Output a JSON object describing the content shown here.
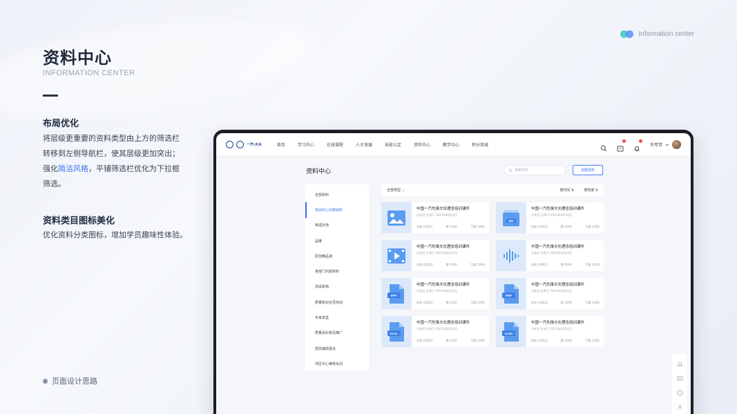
{
  "intro": {
    "title": "资料中心",
    "subtitle": "INFORMATION CENTER",
    "section1_heading": "布局优化",
    "section1_line1": "将层级更重要的资料类型由上方的筛选栏",
    "section1_line2": "转移到左侧导航栏，使其层级更加突出；",
    "section1_line3_pre": "强化",
    "section1_line3_highlight": "简洁风格",
    "section1_line3_post": "，平铺筛选栏优化为下拉框",
    "section1_line4": "筛选。",
    "section2_heading": "资料类目图标美化",
    "section2_text": "优化资料分类图标，增加学员趣味性体验。",
    "footer_note": "页面设计思路",
    "badge_label": "Information center"
  },
  "app": {
    "brand_text": "一汽·大众",
    "nav": [
      "首页",
      "学习中心",
      "在线课程",
      "人才发展",
      "技能认定",
      "资料中心",
      "教学中心",
      "积分商城"
    ],
    "user_name": "许可可",
    "page_title": "资料中心",
    "search_placeholder": "搜索资料",
    "create_button": "创建资料",
    "side_items": [
      "全部资料",
      "培训中心内部资料",
      "英语天地",
      "品推",
      "原创精品课",
      "各部门内部资料",
      "测试新档",
      "质量知识全员培训",
      "专家讲堂",
      "质量百科普及推广",
      "党风廉政建设",
      "冲压中心维修车间"
    ],
    "active_side_index": 1,
    "filter": {
      "type_select": "全部类型",
      "sort_time": "按时间",
      "sort_hot": "按热度"
    },
    "cards": [
      {
        "icon": "image-icon",
        "title": "中国一汽先锋文化理念培训课件",
        "author": "冯东武",
        "sharer": "分享于",
        "date": "2021年8月10日",
        "views": "浏览 (1002)",
        "likes": "赞 (100)",
        "downloads": "下载 (100)"
      },
      {
        "icon": "zip-icon",
        "title": "中国一汽先锋文化理念培训课件",
        "author": "冯东武",
        "sharer": "分享于",
        "date": "2021年8月10日",
        "views": "浏览 (1002)",
        "likes": "赞 (100)",
        "downloads": "下载 (100)"
      },
      {
        "icon": "video-icon",
        "title": "中国一汽先锋文化理念培训课件",
        "author": "冯东武",
        "sharer": "分享于",
        "date": "2021年8月10日",
        "views": "浏览 (1002)",
        "likes": "赞 (100)",
        "downloads": "下载 (100)"
      },
      {
        "icon": "audio-icon",
        "title": "中国一汽先锋文化理念培训课件",
        "author": "冯东武",
        "sharer": "分享于",
        "date": "2021年8月10日",
        "views": "浏览 (1002)",
        "likes": "赞 (100)",
        "downloads": "下载 (100)"
      },
      {
        "icon": "ppt-icon",
        "title": "中国一汽先锋文化理念培训课件",
        "author": "冯东武",
        "sharer": "分享于",
        "date": "2021年8月10日",
        "views": "浏览 (1002)",
        "likes": "赞 (100)",
        "downloads": "下载 (100)"
      },
      {
        "icon": "pdf-icon",
        "title": "中国一汽先锋文化理念培训课件",
        "author": "冯东武",
        "sharer": "分享于",
        "date": "2021年8月10日",
        "views": "浏览 (1002)",
        "likes": "赞 (100)",
        "downloads": "下载 (100)"
      },
      {
        "icon": "excel-icon",
        "title": "中国一汽先锋文化理念培训课件",
        "author": "冯东武",
        "sharer": "分享于",
        "date": "2021年8月10日",
        "views": "浏览 (1002)",
        "likes": "赞 (100)",
        "downloads": "下载 (100)"
      },
      {
        "icon": "word-icon",
        "title": "中国一汽先锋文化理念培训课件",
        "author": "冯东武",
        "sharer": "分享于",
        "date": "2021年8月10日",
        "views": "浏览 (1002)",
        "likes": "赞 (100)",
        "downloads": "下载 (100)"
      }
    ],
    "file_labels": {
      "zip": "ZIP",
      "ppt": "PPT",
      "pdf": "PDF",
      "excel": "EXCEL",
      "word": "WORD"
    }
  },
  "colors": {
    "accent": "#3a6ff0",
    "thumb_bg": "#dde9fb",
    "icon_blue": "#5b9bf0"
  }
}
